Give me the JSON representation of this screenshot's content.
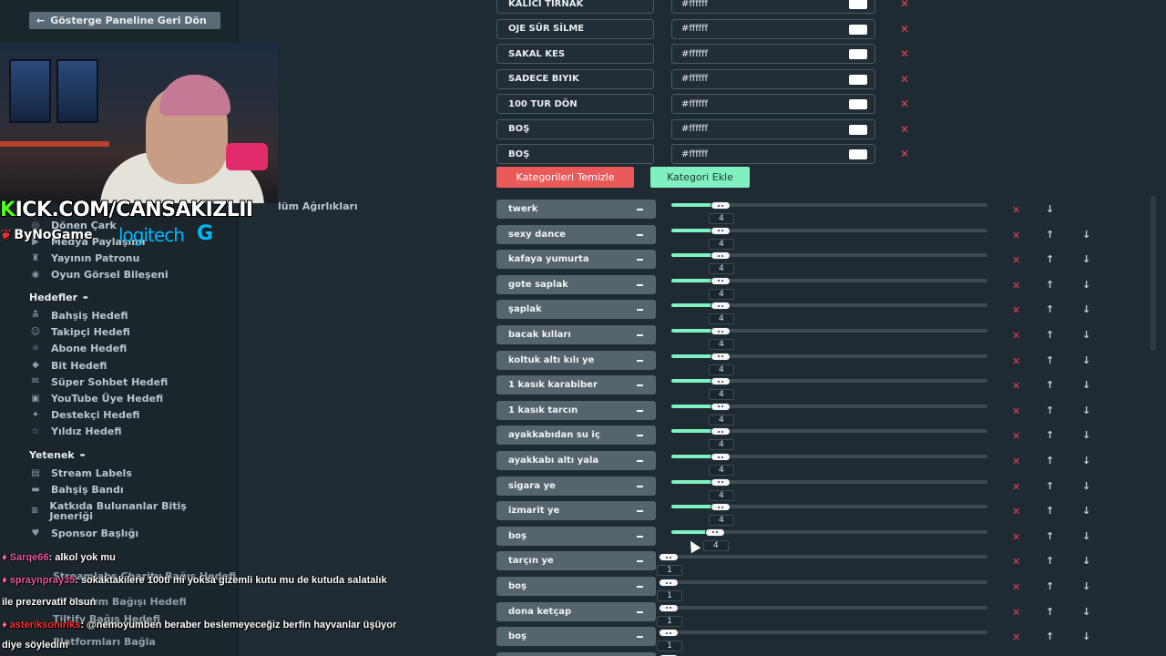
{
  "sidebar": {
    "back_label": "Gösterge Paneline Geri Dön",
    "behind_overlay_label": "lüm Ağırlıkları",
    "top_items": [
      {
        "label": "Dönen Çark",
        "icon": "wheel-icon"
      },
      {
        "label": "Medya Paylaşımı",
        "icon": "media-icon"
      },
      {
        "label": "Yayının Patronu",
        "icon": "boss-icon"
      },
      {
        "label": "Oyun Görsel Bileşeni",
        "icon": "gamepad-icon"
      }
    ],
    "goals_section": "Hedefler",
    "goals": [
      {
        "label": "Bahşiş Hedefi",
        "icon": "tip-icon"
      },
      {
        "label": "Takipçi Hedefi",
        "icon": "follower-icon"
      },
      {
        "label": "Abone Hedefi",
        "icon": "subscriber-icon"
      },
      {
        "label": "Bit Hedefi",
        "icon": "bit-icon"
      },
      {
        "label": "Süper Sohbet Hedefi",
        "icon": "superchat-icon"
      },
      {
        "label": "YouTube Üye Hedefi",
        "icon": "youtube-icon"
      },
      {
        "label": "Destekçi Hedefi",
        "icon": "supporter-icon"
      },
      {
        "label": "Yıldız Hedefi",
        "icon": "star-icon"
      }
    ],
    "skills_section": "Yetenek",
    "skills": [
      {
        "label": "Stream Labels",
        "icon": "labels-icon"
      },
      {
        "label": "Bahşiş Bandı",
        "icon": "tipband-icon"
      },
      {
        "label": "Katkıda Bulunanlar Bitiş Jeneriği",
        "icon": "credits-icon"
      },
      {
        "label": "Sponsor Başlığı",
        "icon": "heart-icon"
      }
    ]
  },
  "overlay": {
    "kick_k": "K",
    "kick_rest": "ICK.COM/CANSAKIZLII",
    "bynogame": "ByNoGame",
    "logitech": "logitech",
    "logitech_g": "G"
  },
  "chat": [
    {
      "user": "Sarqe66",
      "message": ": alkol yok mu",
      "color": "#e45a9a"
    },
    {
      "user": "spraynpray35",
      "message": ": sokaktakilere 100tl mi yoksa gizemli kutu mu de kutuda salatalık",
      "color": "#e45a9a"
    },
    {
      "user": "",
      "message": "ile prezervatif olsun",
      "color": "#e45a9a"
    },
    {
      "user": "asteriksoniriks",
      "message": ": @nemoyumben beraber beslemeyeceğiz berfin hayvanlar üşüyor",
      "color": "#ff3030"
    },
    {
      "user": "",
      "message": "diye söyledim",
      "color": "#ff3030"
    }
  ],
  "chat_hidden_items": [
    "Streamlabs Charity Bağış Hedefi",
    "ch Yardım Bağışı Hedefi",
    "Tiltify Bağış Hedefi",
    "Platformları Bağla"
  ],
  "categories_top": [
    {
      "name": "KALICI TIRNAK",
      "color": "#ffffff"
    },
    {
      "name": "OJE SÜR SİLME",
      "color": "#ffffff"
    },
    {
      "name": "SAKAL KES",
      "color": "#ffffff"
    },
    {
      "name": "SADECE BIYIK",
      "color": "#ffffff"
    },
    {
      "name": "100 TUR DÖN",
      "color": "#ffffff"
    },
    {
      "name": "BOŞ",
      "color": "#ffffff"
    },
    {
      "name": "BOŞ",
      "color": "#ffffff"
    }
  ],
  "buttons": {
    "clear": "Kategorileri Temizle",
    "add": "Kategori Ekle"
  },
  "weights": [
    {
      "name": "twerk",
      "value": "4"
    },
    {
      "name": "sexy dance",
      "value": "4"
    },
    {
      "name": "kafaya yumurta",
      "value": "4"
    },
    {
      "name": "gote saplak",
      "value": "4"
    },
    {
      "name": "şaplak",
      "value": "4"
    },
    {
      "name": "bacak kılları",
      "value": "4"
    },
    {
      "name": "koltuk altı kılı ye",
      "value": "4"
    },
    {
      "name": "1 kasık karabiber",
      "value": "4"
    },
    {
      "name": "1 kasık tarcın",
      "value": "4"
    },
    {
      "name": "ayakkabıdan su iç",
      "value": "4"
    },
    {
      "name": "ayakkabı altı yala",
      "value": "4"
    },
    {
      "name": "sigara ye",
      "value": "4"
    },
    {
      "name": "izmarit ye",
      "value": "4"
    },
    {
      "name": "boş",
      "value": "4"
    },
    {
      "name": "tarçın ye",
      "value": "1"
    },
    {
      "name": "boş",
      "value": "1"
    },
    {
      "name": "dona ketçap",
      "value": "1"
    },
    {
      "name": "boş",
      "value": "1"
    },
    {
      "name": "",
      "value": "1"
    }
  ],
  "colors": {
    "accent": "#7ff2c0",
    "danger": "#e0454f",
    "clear_button": "#ea5a5a",
    "add_button": "#80f0c0"
  }
}
